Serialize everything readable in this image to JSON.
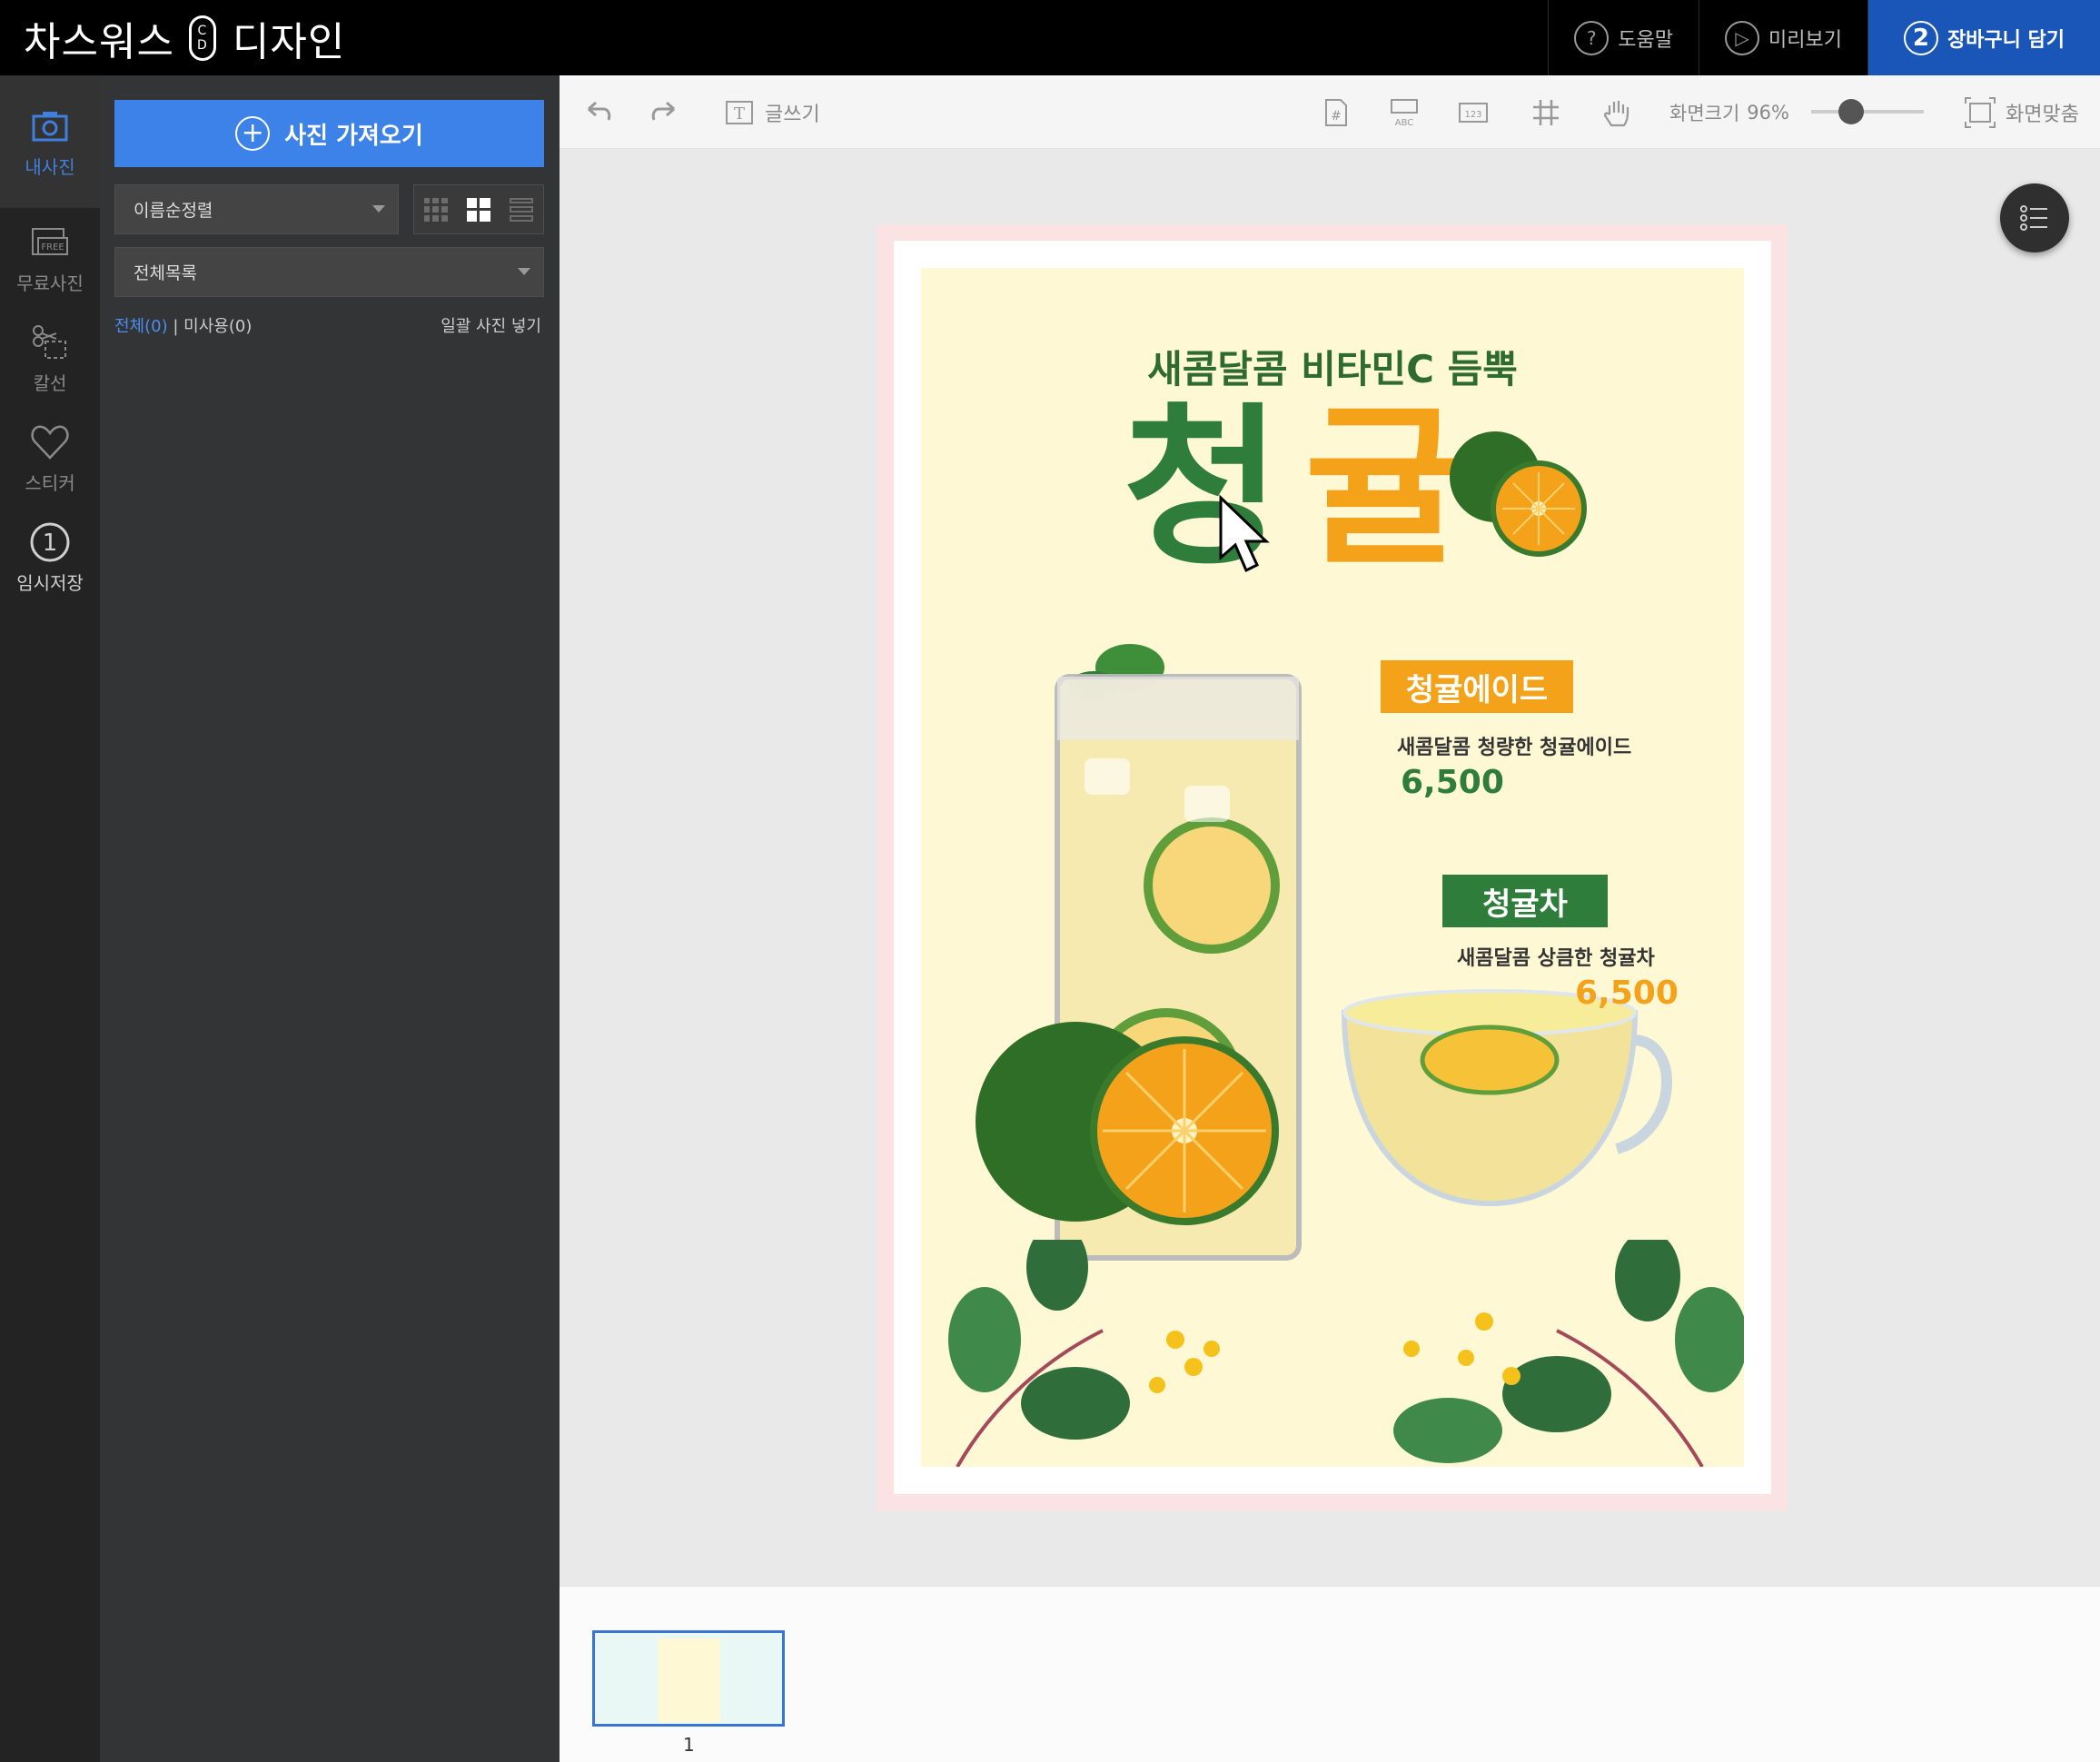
{
  "app": {
    "brand_left": "차스워스",
    "brand_cd_top": "C",
    "brand_cd_bottom": "D",
    "brand_right": "디자인"
  },
  "top_actions": {
    "help": "도움말",
    "preview": "미리보기",
    "cart_step": "2",
    "cart": "장바구니 담기"
  },
  "rail": {
    "items": [
      {
        "label": "내사진",
        "icon": "camera-icon"
      },
      {
        "label": "무료사진",
        "icon": "free-photo-icon"
      },
      {
        "label": "칼선",
        "icon": "scissors-icon"
      },
      {
        "label": "스티커",
        "icon": "heart-icon"
      },
      {
        "label": "임시저장",
        "icon": "temp-save-icon",
        "badge": "1"
      }
    ]
  },
  "panel": {
    "upload_label": "사진 가져오기",
    "sort_select": "이름순정렬",
    "folder_select": "전체목록",
    "count_all": "전체(0)",
    "separator": "|",
    "count_unused": "미사용(0)",
    "bulk_insert": "일괄 사진 넣기"
  },
  "toolbar": {
    "write_text": "글쓰기",
    "zoom_label": "화면크기",
    "zoom_value": "96%",
    "zoom_level": 0.96,
    "fit_screen": "화면맞춤",
    "abc": "ABC",
    "num": "123"
  },
  "poster": {
    "headline": "새콤달콤 비타민C 듬뿍",
    "title_char_1": "청",
    "title_char_2": "귤",
    "item1_badge": "청귤에이드",
    "item1_desc": "새콤달콤 청량한 청귤에이드",
    "item1_price": "6,500",
    "item2_badge": "청귤차",
    "item2_desc": "새콤달콤 상큼한 청귤차",
    "item2_price": "6,500",
    "colors": {
      "green": "#2f7d3a",
      "orange": "#f5a21b",
      "background": "#fff8d4"
    }
  },
  "pages": {
    "current_number": "1"
  }
}
